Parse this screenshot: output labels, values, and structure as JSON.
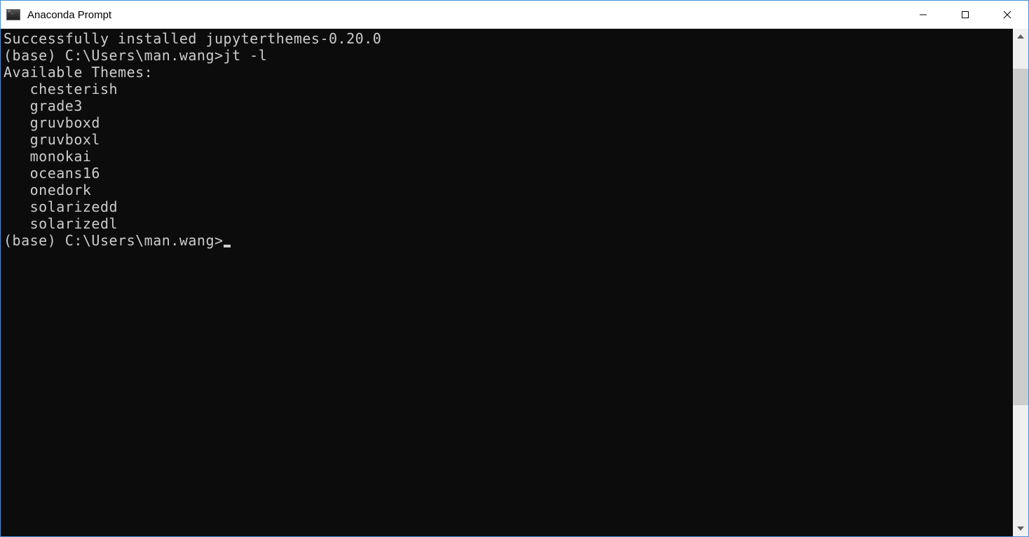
{
  "window": {
    "title": "Anaconda Prompt"
  },
  "terminal": {
    "lines": [
      "Successfully installed jupyterthemes-0.20.0",
      "",
      "(base) C:\\Users\\man.wang>jt -l",
      "Available Themes: ",
      "   chesterish",
      "   grade3",
      "   gruvboxd",
      "   gruvboxl",
      "   monokai",
      "   oceans16",
      "   onedork",
      "   solarizedd",
      "   solarizedl",
      ""
    ],
    "prompt": "(base) C:\\Users\\man.wang>"
  }
}
